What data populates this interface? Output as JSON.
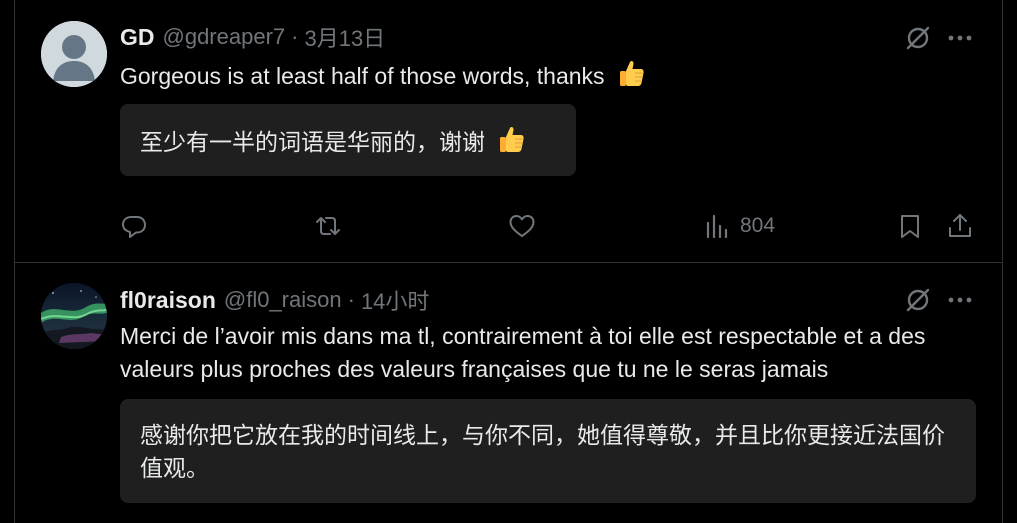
{
  "tweets": [
    {
      "name": "GD",
      "handle": "@gdreaper7",
      "separator": "·",
      "time": "3月13日",
      "text": "Gorgeous is at least half of those words, thanks",
      "translation": "至少有一半的词语是华丽的，谢谢",
      "stats": {
        "views": "804"
      }
    },
    {
      "name": "fl0raison",
      "handle": "@fl0_raison",
      "separator": "·",
      "time": "14小时",
      "text": "Merci de l’avoir mis dans ma tl, contrairement à toi elle est respectable et a des valeurs plus proches des valeurs françaises que tu ne le seras jamais",
      "translation": "感谢你把它放在我的时间线上，与你不同，她值得尊敬，并且比你更接近法国价值观。"
    }
  ],
  "icons": {
    "reply": "reply-icon",
    "retweet": "retweet-icon",
    "like": "like-icon",
    "views": "views-icon",
    "bookmark": "bookmark-icon",
    "share": "share-icon",
    "grok": "grok-icon",
    "more": "more-icon",
    "thumbs_up": "thumbs-up-emoji"
  },
  "colors": {
    "background": "#000000",
    "text": "#e7e9ea",
    "secondary": "#71767b",
    "translation_bg": "#1f1f1f",
    "divider": "#2f3336"
  }
}
